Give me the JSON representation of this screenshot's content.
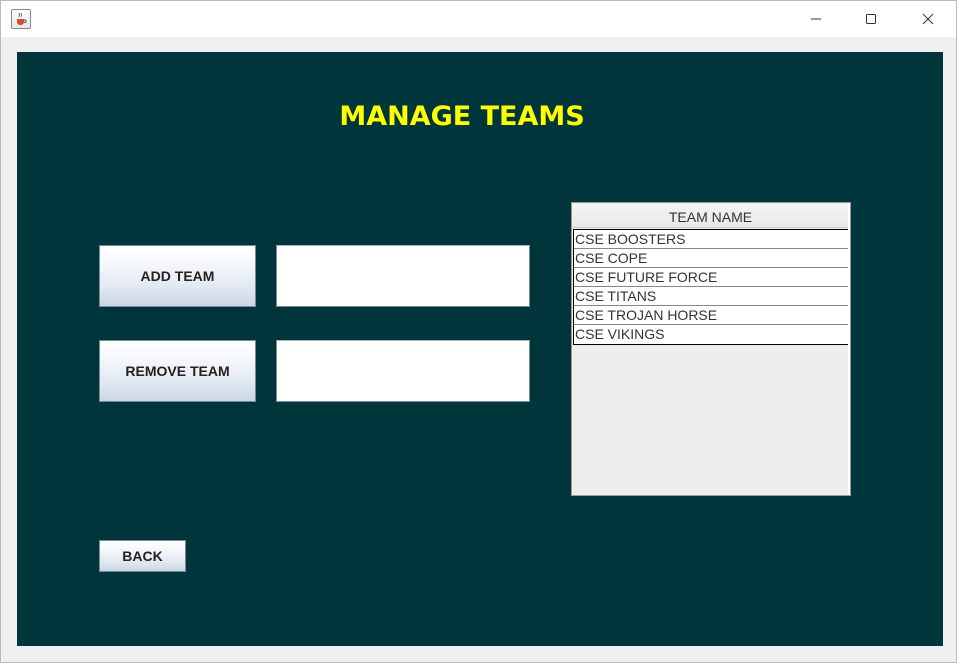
{
  "window": {
    "app_icon": "java-cup-icon",
    "controls": [
      "minimize-icon",
      "maximize-icon",
      "close-icon"
    ]
  },
  "main": {
    "title": "MANAGE TEAMS",
    "add_team_label": "ADD TEAM",
    "add_team_value": "",
    "remove_team_label": "REMOVE TEAM",
    "remove_team_value": "",
    "back_label": "BACK"
  },
  "table": {
    "columns": [
      "TEAM NAME"
    ],
    "rows": [
      "CSE BOOSTERS",
      "CSE COPE",
      "CSE FUTURE FORCE",
      "CSE TITANS",
      "CSE TROJAN HORSE",
      "CSE VIKINGS"
    ]
  },
  "colors": {
    "background": "#00363b",
    "title": "#ffff00"
  }
}
